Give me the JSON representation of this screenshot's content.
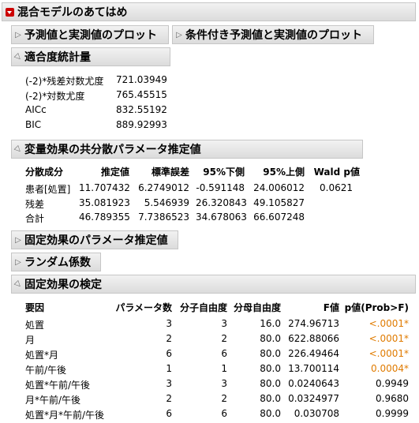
{
  "title": "混合モデルのあてはめ",
  "buttons": {
    "pred_plot": "予測値と実測値のプロット",
    "cond_pred_plot": "条件付き予測値と実測値のプロット"
  },
  "fit_stats": {
    "title": "適合度統計量",
    "rows": [
      {
        "label": "(-2)*残差対数尤度",
        "value": "721.03949"
      },
      {
        "label": "(-2)*対数尤度",
        "value": "765.45515"
      },
      {
        "label": "AICc",
        "value": "832.55192"
      },
      {
        "label": "BIC",
        "value": "889.92993"
      }
    ]
  },
  "covariance": {
    "title": "変量効果の共分散パラメータ推定値",
    "headers": [
      "分散成分",
      "推定値",
      "標準誤差",
      "95%下側",
      "95%上側",
      "Wald p値"
    ],
    "rows": [
      [
        "患者[処置]",
        "11.707432",
        "6.2749012",
        "-0.591148",
        "24.006012",
        "0.0621"
      ],
      [
        "残差",
        "35.081923",
        "5.546939",
        "26.320843",
        "49.105827",
        ""
      ],
      [
        "合計",
        "46.789355",
        "7.7386523",
        "34.678063",
        "66.607248",
        ""
      ]
    ]
  },
  "fixed_params": {
    "title": "固定効果のパラメータ推定値"
  },
  "random_coef": {
    "title": "ランダム係数"
  },
  "fixed_tests": {
    "title": "固定効果の検定",
    "headers": [
      "要因",
      "パラメータ数",
      "分子自由度",
      "分母自由度",
      "F値",
      "p値(Prob>F)"
    ],
    "rows": [
      [
        "処置",
        "3",
        "3",
        "16.0",
        "274.96713",
        "<.0001*"
      ],
      [
        "月",
        "2",
        "2",
        "80.0",
        "622.88066",
        "<.0001*"
      ],
      [
        "処置*月",
        "6",
        "6",
        "80.0",
        "226.49464",
        "<.0001*"
      ],
      [
        "午前/午後",
        "1",
        "1",
        "80.0",
        "13.700114",
        "0.0004*"
      ],
      [
        "処置*午前/午後",
        "3",
        "3",
        "80.0",
        "0.0240643",
        "0.9949"
      ],
      [
        "月*午前/午後",
        "2",
        "2",
        "80.0",
        "0.0324977",
        "0.9680"
      ],
      [
        "処置*月*午前/午後",
        "6",
        "6",
        "80.0",
        "0.030708",
        "0.9999"
      ]
    ],
    "significant_color": "#e07b00"
  }
}
